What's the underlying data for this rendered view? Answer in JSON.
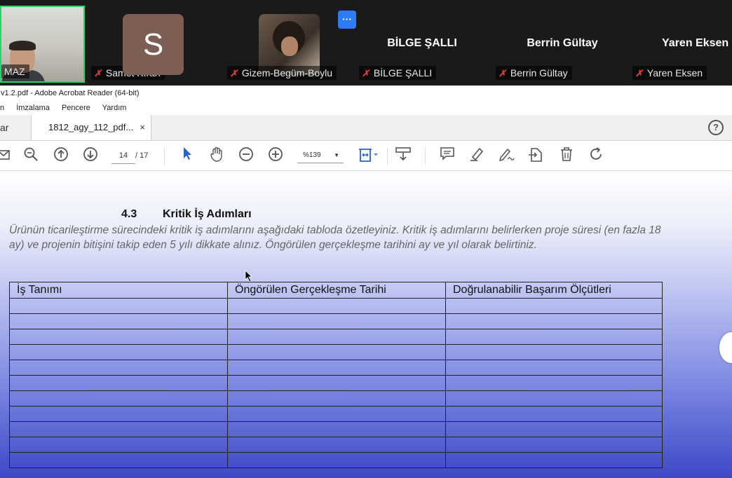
{
  "meeting": {
    "participants": [
      {
        "label": "MAZ"
      },
      {
        "initial": "S",
        "label": "Samet Kıran"
      },
      {
        "label": "Gizem-Begüm-Boylu"
      },
      {
        "name": "BİLGE ŞALLI",
        "label": "BİLGE ŞALLI"
      },
      {
        "name": "Berrin Gültay",
        "label": "Berrin Gültay"
      },
      {
        "name": "Yaren Eksen",
        "label": "Yaren Eksen"
      }
    ],
    "more_label": "···",
    "mic_icon": "muted-mic-icon"
  },
  "window": {
    "title": "v1.2.pdf - Adobe Acrobat Reader (64-bit)"
  },
  "menu": [
    "n",
    "İmzalama",
    "Pencere",
    "Yardım"
  ],
  "tabs": {
    "home": "ar",
    "doc": "1812_agy_112_pdf...",
    "close": "×",
    "help": "?"
  },
  "toolbar": {
    "page_current": "14",
    "page_total": "/ 17",
    "zoom": "%139",
    "zoom_arrow": "▼",
    "icons": [
      "email-icon",
      "zoom-out-magnifier-icon",
      "page-up-icon",
      "page-down-icon",
      "select-cursor-icon",
      "hand-icon",
      "zoom-out-icon",
      "zoom-in-icon",
      "fit-page-icon",
      "scroll-mode-icon",
      "comment-icon",
      "highlight-icon",
      "sign-icon",
      "stamp-icon",
      "delete-icon",
      "rotate-icon"
    ]
  },
  "document": {
    "section_number": "4.3",
    "section_title": "Kritik İş Adımları",
    "paragraph": "Ürünün ticarileştirme sürecindeki kritik iş adımlarını aşağıdaki tabloda özetleyiniz. Kritik iş adımlarını belirlerken proje süresi (en fazla 18 ay) ve projenin bitişini takip eden 5 yılı dikkate alınız. Öngörülen gerçekleşme tarihini ay ve yıl olarak belirtiniz.",
    "table_headers": [
      "İş Tanımı",
      "Öngörülen Gerçekleşme Tarihi",
      "Doğrulanabilir Başarım Ölçütleri"
    ],
    "empty_rows": 11
  }
}
